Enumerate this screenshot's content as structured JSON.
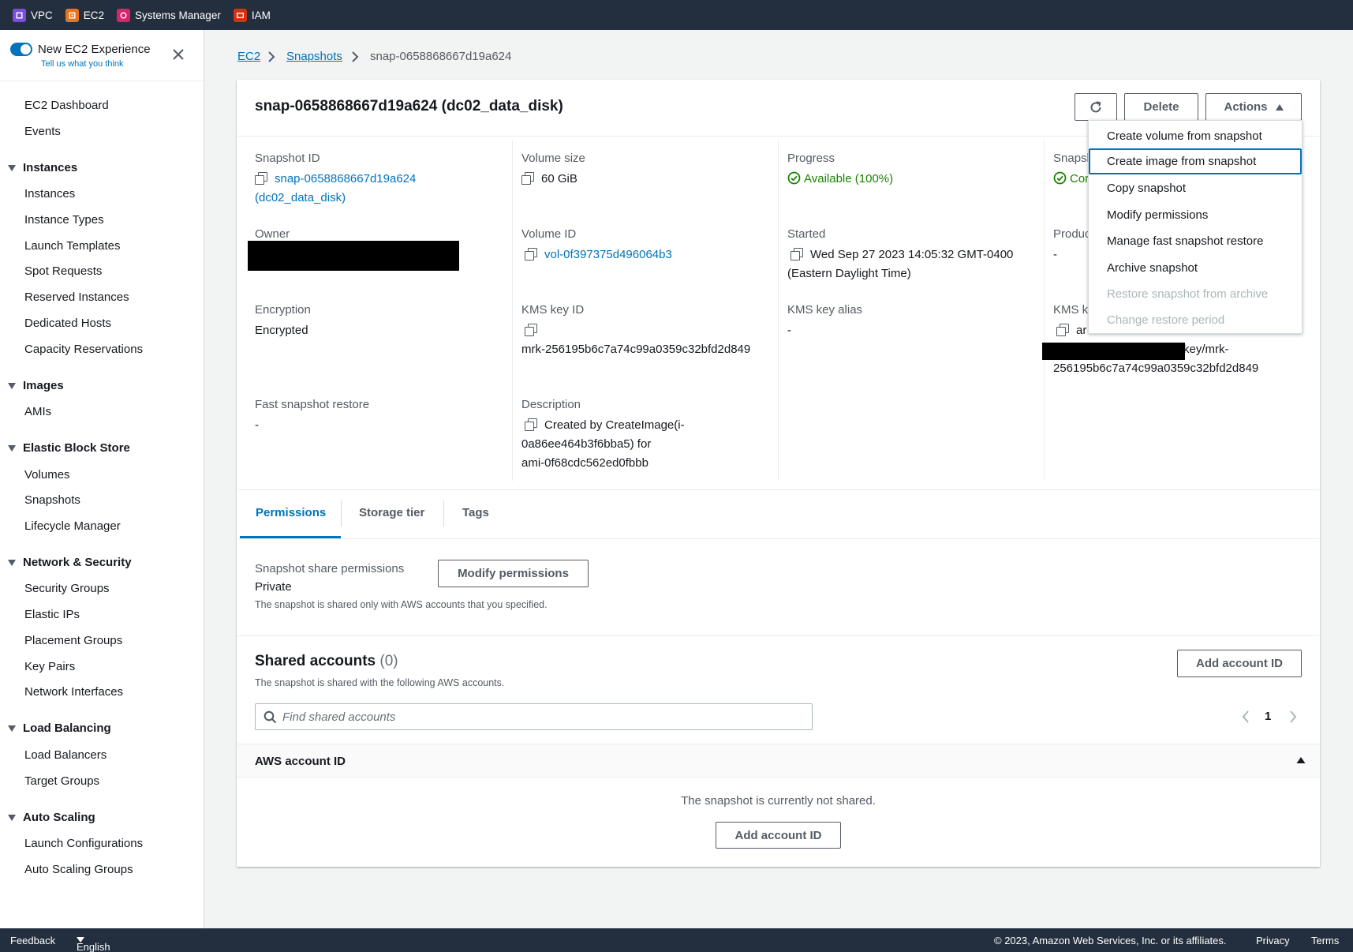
{
  "top_services": [
    {
      "label": "VPC",
      "color": "#7b4ed8"
    },
    {
      "label": "EC2",
      "color": "#e7731b"
    },
    {
      "label": "Systems Manager",
      "color": "#d1286c"
    },
    {
      "label": "IAM",
      "color": "#d13212"
    }
  ],
  "new_experience": {
    "title": "New EC2 Experience",
    "feedback_link": "Tell us what you think",
    "enabled": true
  },
  "sidebar": {
    "dashboard": "EC2 Dashboard",
    "events": "Events",
    "sections": [
      {
        "title": "Instances",
        "items": [
          "Instances",
          "Instance Types",
          "Launch Templates",
          "Spot Requests",
          "Reserved Instances",
          "Dedicated Hosts",
          "Capacity Reservations"
        ]
      },
      {
        "title": "Images",
        "items": [
          "AMIs"
        ]
      },
      {
        "title": "Elastic Block Store",
        "items": [
          "Volumes",
          "Snapshots",
          "Lifecycle Manager"
        ]
      },
      {
        "title": "Network & Security",
        "items": [
          "Security Groups",
          "Elastic IPs",
          "Placement Groups",
          "Key Pairs",
          "Network Interfaces"
        ]
      },
      {
        "title": "Load Balancing",
        "items": [
          "Load Balancers",
          "Target Groups"
        ]
      },
      {
        "title": "Auto Scaling",
        "items": [
          "Launch Configurations",
          "Auto Scaling Groups"
        ]
      }
    ]
  },
  "breadcrumb": [
    "EC2",
    "Snapshots",
    "snap-0658868667d19a624"
  ],
  "page_title": "snap-0658868667d19a624 (dc02_data_disk)",
  "buttons": {
    "delete": "Delete",
    "actions": "Actions"
  },
  "details": {
    "snapshot_id": {
      "label": "Snapshot ID",
      "line1": "snap-0658868667d19a624",
      "line2": "(dc02_data_disk)"
    },
    "volume_size": {
      "label": "Volume size",
      "value": "60 GiB"
    },
    "progress": {
      "label": "Progress",
      "value": "Available (100%)"
    },
    "snapshot_status": {
      "label": "Snapsl",
      "value": "Cor"
    },
    "owner": {
      "label": "Owner"
    },
    "volume_id": {
      "label": "Volume ID",
      "value": "vol-0f397375d496064b3"
    },
    "started": {
      "label": "Started",
      "line1": "Wed Sep 27 2023 14:05:32 GMT-0400",
      "line2": "(Eastern Daylight Time)"
    },
    "product_codes": {
      "label": "Produc",
      "value": "-"
    },
    "encryption": {
      "label": "Encryption",
      "value": "Encrypted"
    },
    "kms_key_id": {
      "label": "KMS key ID",
      "value": "mrk-256195b6c7a74c99a0359c32bfd2d849"
    },
    "kms_key_alias": {
      "label": "KMS key alias",
      "value": "-"
    },
    "kms_key_arn": {
      "label": "KMS ke",
      "line1": "ar",
      "line2": "key/mrk-",
      "line3": "256195b6c7a74c99a0359c32bfd2d849"
    },
    "fast_restore": {
      "label": "Fast snapshot restore",
      "value": "-"
    },
    "description": {
      "label": "Description",
      "line1": "Created by CreateImage(i-",
      "line2": "0a86ee464b3f6bba5) for",
      "line3": "ami-0f68cdc562ed0fbbb"
    }
  },
  "tabs": [
    "Permissions",
    "Storage tier",
    "Tags"
  ],
  "permissions": {
    "label": "Snapshot share permissions",
    "value": "Private",
    "note": "The snapshot is shared only with AWS accounts that you specified.",
    "modify_button": "Modify permissions"
  },
  "shared_accounts": {
    "title": "Shared accounts",
    "count": "(0)",
    "subtitle": "The snapshot is shared with the following AWS accounts.",
    "add_button": "Add account ID",
    "search_placeholder": "Find shared accounts",
    "page": "1",
    "column": "AWS account ID",
    "empty_text": "The snapshot is currently not shared.",
    "empty_add_button": "Add account ID"
  },
  "actions_menu": [
    {
      "label": "Create volume from snapshot",
      "state": "normal"
    },
    {
      "label": "Create image from snapshot",
      "state": "focused"
    },
    {
      "label": "Copy snapshot",
      "state": "normal"
    },
    {
      "label": "Modify permissions",
      "state": "normal"
    },
    {
      "label": "Manage fast snapshot restore",
      "state": "normal"
    },
    {
      "label": "Archive snapshot",
      "state": "normal"
    },
    {
      "label": "Restore snapshot from archive",
      "state": "disabled"
    },
    {
      "label": "Change restore period",
      "state": "disabled"
    }
  ],
  "footer": {
    "feedback": "Feedback",
    "language": "English",
    "copyright": "© 2023, Amazon Web Services, Inc. or its affiliates.",
    "privacy": "Privacy",
    "terms": "Terms"
  }
}
